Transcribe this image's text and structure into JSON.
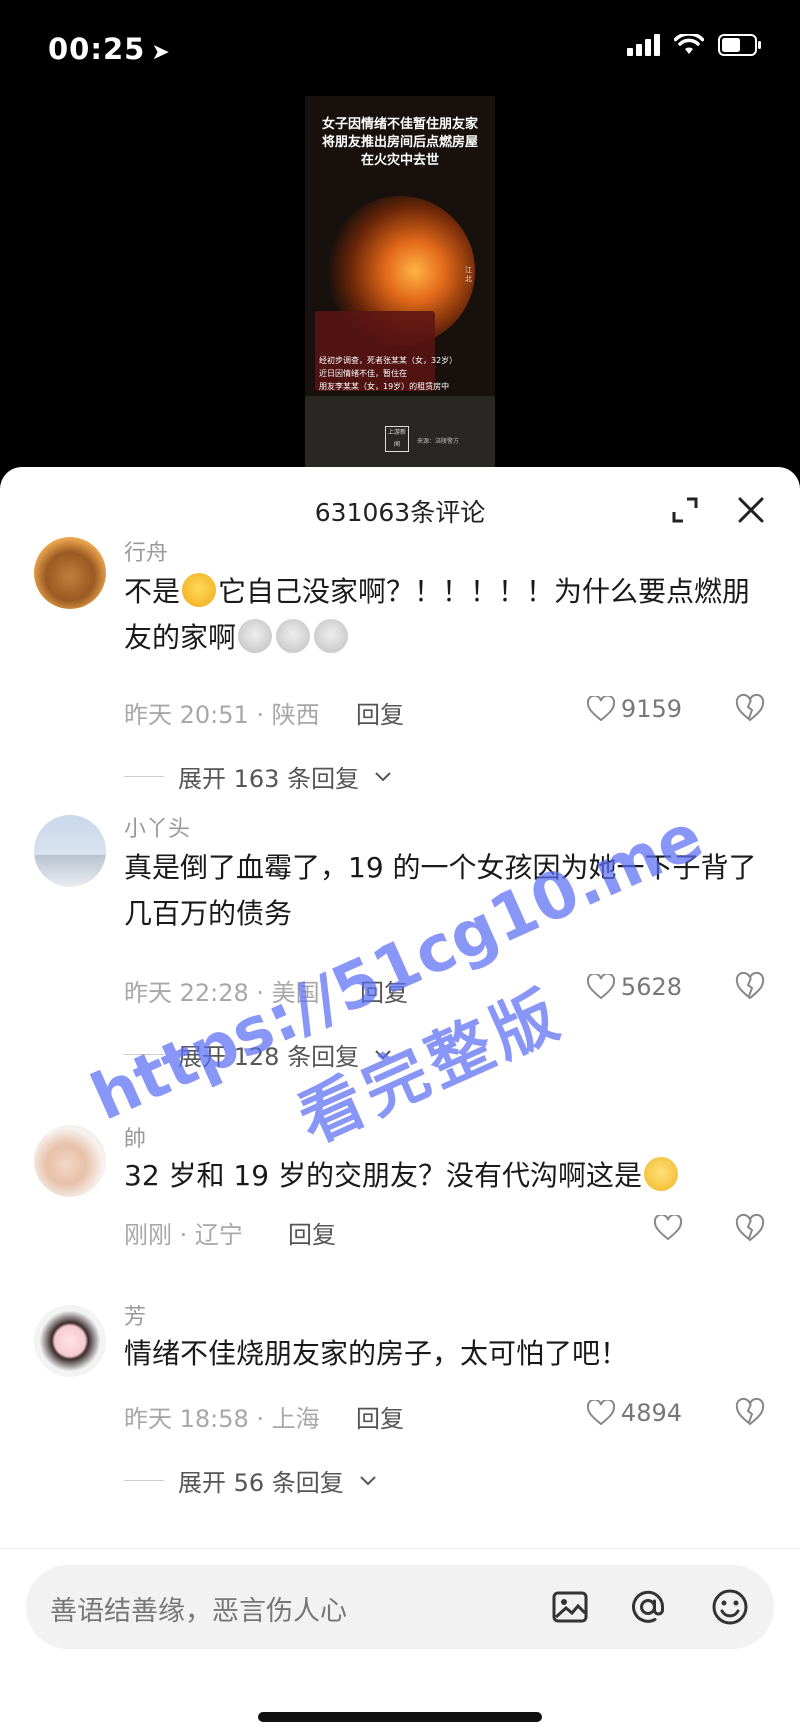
{
  "status": {
    "time": "00:25"
  },
  "video": {
    "title_lines": [
      "女子因情绪不佳暂住朋友家",
      "将朋友推出房间后点燃房屋",
      "在火灾中去世"
    ],
    "caption_lines": [
      "经初步调查，死者张某某（女，32岁）",
      "近日因情绪不佳，暂住在",
      "朋友李某某（女，19岁）的租赁房中"
    ],
    "logo": "上游新闻",
    "credit": "来源：涪陵警方",
    "side_text": "江北"
  },
  "header": {
    "title": "631063条评论"
  },
  "comments": [
    {
      "name": "行舟",
      "text_a": "不是",
      "text_b": "它自己没家啊？！！！！！为什么要点燃朋友的家啊",
      "time_loc": "昨天 20:51 · 陕西",
      "reply": "回复",
      "likes": "9159",
      "expand": "展开 163 条回复"
    },
    {
      "name": "小丫头",
      "text": "真是倒了血霉了，19 的一个女孩因为她一下子背了几百万的债务",
      "time_loc": "昨天 22:28 · 美国",
      "reply": "回复",
      "likes": "5628",
      "expand": "展开 128 条回复"
    },
    {
      "name": "帥",
      "text": "32 岁和 19 岁的交朋友？没有代沟啊这是",
      "time_loc": "刚刚 · 辽宁",
      "reply": "回复"
    },
    {
      "name": "芳",
      "text": "情绪不佳烧朋友家的房子，太可怕了吧！",
      "time_loc": "昨天 18:58 · 上海",
      "reply": "回复",
      "likes": "4894",
      "expand": "展开 56 条回复"
    }
  ],
  "watermark": {
    "line1": "https://51cg10.me",
    "line2": "看完整版"
  },
  "input": {
    "placeholder": "善语结善缘，恶言伤人心"
  }
}
